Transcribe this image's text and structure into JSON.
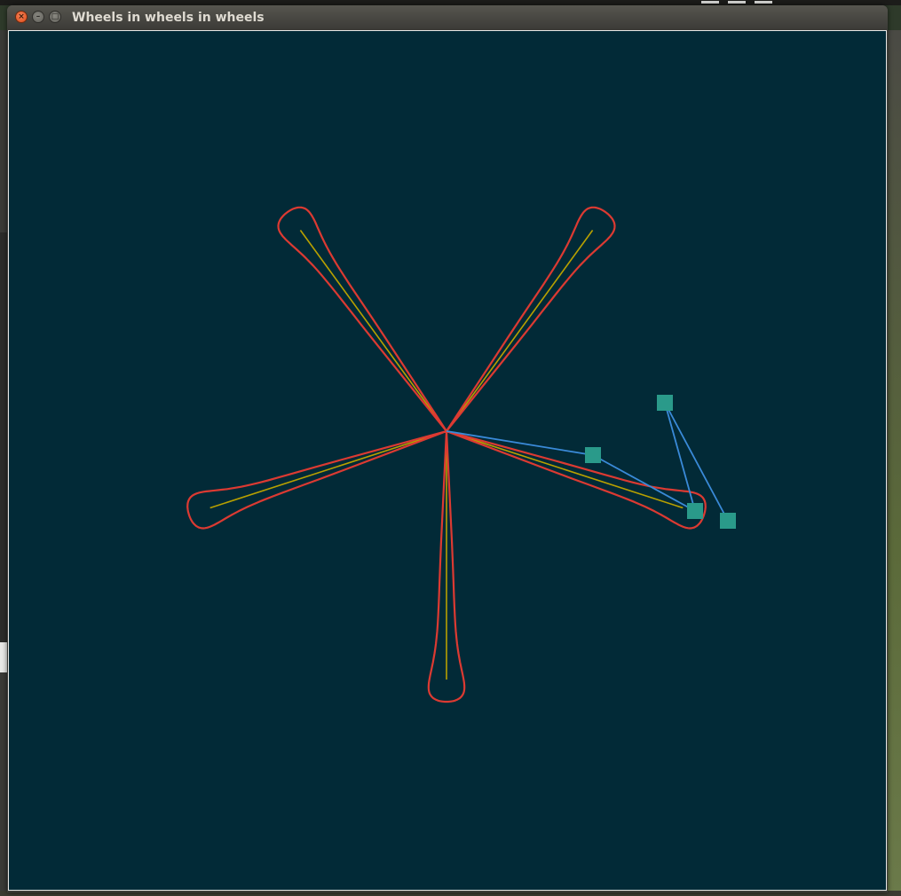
{
  "window": {
    "title": "Wheels in wheels in wheels",
    "close_icon": "close-icon",
    "minimize_icon": "minimize-icon",
    "maximize_icon": "maximize-icon"
  },
  "colors": {
    "background": "#022a37",
    "curve": "#dc3a32",
    "spokes": "#b8a000",
    "arms": "#3a8ad8",
    "nodes": "#2a9a8a"
  },
  "drawing": {
    "petal_count": 5
  }
}
